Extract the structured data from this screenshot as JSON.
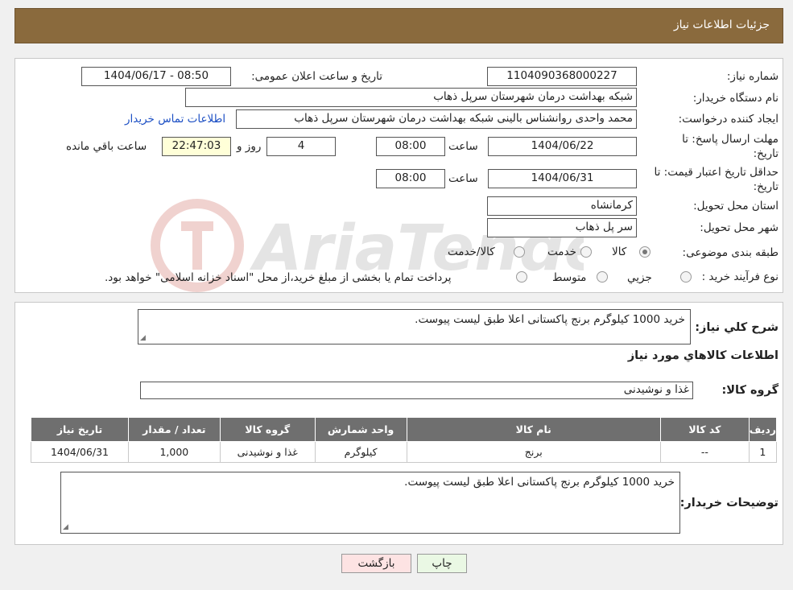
{
  "header": {
    "title": "جزئیات اطلاعات نیاز"
  },
  "form": {
    "need_number_label": "شماره نیاز:",
    "need_number": "1104090368000227",
    "announce_label": "تاریخ و ساعت اعلان عمومی:",
    "announce_value": "1404/06/17 - 08:50",
    "buyer_org_label": "نام دستگاه خریدار:",
    "buyer_org": "شبکه بهداشت درمان شهرستان سرپل ذهاب",
    "requester_label": "ایجاد کننده درخواست:",
    "requester": "محمد واحدی روانشناس بالینی شبکه بهداشت درمان شهرستان سرپل ذهاب",
    "contact_link": "اطلاعات تماس خریدار",
    "deadline_label_1": "مهلت ارسال پاسخ: تا",
    "deadline_label_2": "تاریخ:",
    "deadline_date": "1404/06/22",
    "time_label": "ساعت",
    "deadline_time": "08:00",
    "days_value": "4",
    "days_label": "روز و",
    "remaining_time": "22:47:03",
    "remaining_label": "ساعت باقي مانده",
    "validity_label_1": "حداقل تاریخ اعتبار قیمت: تا",
    "validity_label_2": "تاریخ:",
    "validity_date": "1404/06/31",
    "validity_time_label": "ساعت",
    "validity_time": "08:00",
    "province_label": "استان محل تحویل:",
    "province": "کرمانشاه",
    "city_label": "شهر محل تحویل:",
    "city": "سر پل ذهاب",
    "category_label": "طبقه بندی موضوعی:",
    "category_options": [
      "کالا",
      "خدمت",
      "کالا/خدمت"
    ],
    "category_selected": "کالا",
    "process_label": "نوع فرآیند خرید :",
    "process_options": [
      "جزیي",
      "متوسط"
    ],
    "process_note": "پرداخت تمام یا بخشی از مبلغ خرید،از محل \"اسناد خزانه اسلامی\" خواهد بود."
  },
  "details": {
    "summary_label": "شرح کلي نياز:",
    "summary": "خرید 1000 کیلوگرم برنج پاکستانی اعلا طبق لیست پیوست.",
    "goods_title": "اطلاعات کالاهاي مورد نياز",
    "group_label": "گروه کالا:",
    "group_value": "غذا و نوشیدنی",
    "table": {
      "headers": [
        "رديف",
        "کد کالا",
        "نام کالا",
        "واحد شمارش",
        "گروه کالا",
        "تعداد / مقدار",
        "تاریخ نیاز"
      ],
      "rows": [
        [
          "1",
          "--",
          "برنج",
          "کیلوگرم",
          "غذا و نوشیدنی",
          "1,000",
          "1404/06/31"
        ]
      ]
    },
    "buyer_notes_label": "توضیحات خریدار:",
    "buyer_notes": "خرید 1000 کیلوگرم برنج پاکستانی اعلا طبق لیست پیوست."
  },
  "buttons": {
    "print": "چاپ",
    "back": "بازگشت"
  },
  "watermark": {
    "text": "AriaTender.neT"
  },
  "colors": {
    "header_bg": "#8a6a3d",
    "table_header_bg": "#6f6f6f",
    "print_bg": "#eaf8e4",
    "back_bg": "#fde3e3",
    "link": "#1c4fc4"
  }
}
